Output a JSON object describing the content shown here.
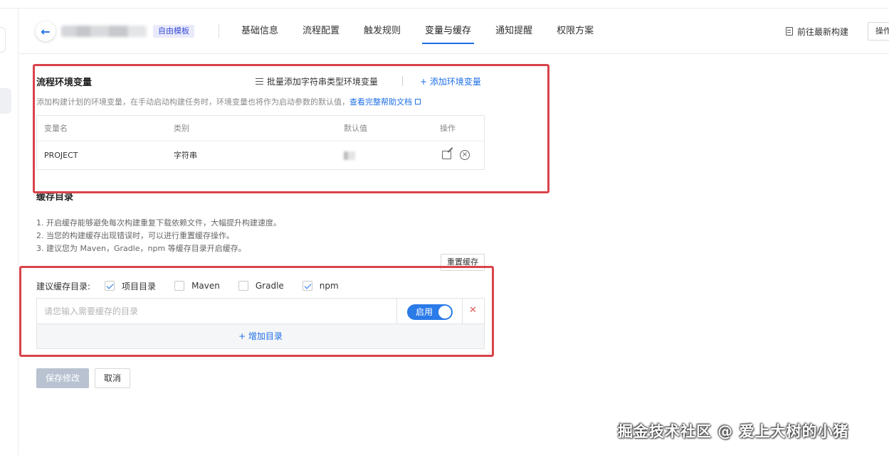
{
  "header": {
    "template_badge": "自由模板",
    "tabs": [
      {
        "label": "基础信息"
      },
      {
        "label": "流程配置"
      },
      {
        "label": "触发规则"
      },
      {
        "label": "变量与缓存"
      },
      {
        "label": "通知提醒"
      },
      {
        "label": "权限方案"
      }
    ],
    "active_tab": "变量与缓存",
    "goto_latest_label": "前往最新构建",
    "ops_label": "操作"
  },
  "env": {
    "title": "流程环境变量",
    "batch_add_label": "批量添加字符串类型环境变量",
    "add_label": "+ 添加环境变量",
    "desc": "添加构建计划的环境变量，在手动启动构建任务时，环境变量也将作为启动参数的默认值，",
    "help_link": "查看完整帮助文档",
    "columns": [
      "变量名",
      "类别",
      "默认值",
      "操作"
    ],
    "rows": [
      {
        "name": "PROJECT",
        "type": "字符串"
      }
    ]
  },
  "cache": {
    "title": "缓存目录",
    "tips": [
      "1. 开启缓存能够避免每次构建重复下载依赖文件，大幅提升构建速度。",
      "2. 当您的构建缓存出现错误时，可以进行重置缓存操作。",
      "3. 建议您为 Maven，Gradle，npm 等缓存目录开启缓存。"
    ],
    "reset_label": "重置缓存",
    "suggest_label": "建议缓存目录:",
    "options": [
      {
        "label": "项目目录",
        "checked": true
      },
      {
        "label": "Maven",
        "checked": false
      },
      {
        "label": "Gradle",
        "checked": false
      },
      {
        "label": "npm",
        "checked": true
      }
    ],
    "dir_placeholder": "请您输入需要缓存的目录",
    "switch_label": "启用",
    "remove_glyph": "✕",
    "add_dir_label": "+ 增加目录"
  },
  "actions": {
    "save_label": "保存修改",
    "cancel_label": "取消"
  },
  "watermark": "掘金技术社区 @ 爱上大树的小猪",
  "colors": {
    "accent": "#1e6fe6",
    "highlight": "#d9434b",
    "danger": "#e05a5a",
    "disabled_button": "#b8c2d0"
  }
}
